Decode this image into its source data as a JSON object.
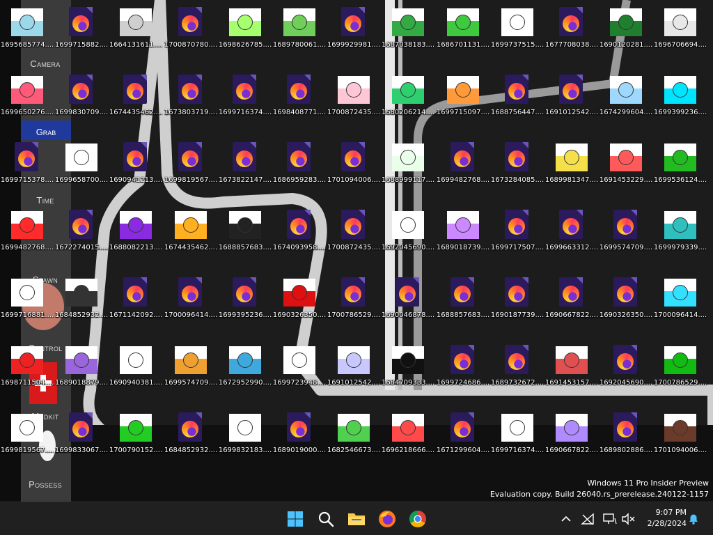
{
  "wallpaper": {
    "sidebar_labels": [
      "Camera",
      "Grab",
      "Time",
      "Spawn",
      "Control",
      "Medkit",
      "Possess"
    ],
    "sidebar_selected": "Grab"
  },
  "desktop": {
    "icons": [
      {
        "label": "1695685774....",
        "type": "img",
        "tint": "#9ad8ea"
      },
      {
        "label": "1699715882....",
        "type": "ff"
      },
      {
        "label": "1664131611....",
        "type": "img",
        "tint": "#cfcfcf"
      },
      {
        "label": "1700870780....",
        "type": "ff"
      },
      {
        "label": "1698626785....",
        "type": "img",
        "tint": "#a6ff6e"
      },
      {
        "label": "1689780061....",
        "type": "img",
        "tint": "#6fcf5a"
      },
      {
        "label": "1699929981....",
        "type": "ff"
      },
      {
        "label": "1687038183....",
        "type": "img",
        "tint": "#33aa44"
      },
      {
        "label": "1686701131....",
        "type": "img",
        "tint": "#3fc93f"
      },
      {
        "label": "1699737515....",
        "type": "img",
        "tint": "#ffffff"
      },
      {
        "label": "1677708038....",
        "type": "ff"
      },
      {
        "label": "1690120281....",
        "type": "img",
        "tint": "#1f7f2f"
      },
      {
        "label": "1696706694....",
        "type": "img",
        "tint": "#e8e8e8"
      },
      {
        "label": "1699650276....",
        "type": "img",
        "tint": "#ff5a7a"
      },
      {
        "label": "1699830709....",
        "type": "ff"
      },
      {
        "label": "1674435462....",
        "type": "ff"
      },
      {
        "label": "1673803719....",
        "type": "ff"
      },
      {
        "label": "1699716374....",
        "type": "ff"
      },
      {
        "label": "1698408771....",
        "type": "ff"
      },
      {
        "label": "1700872435....",
        "type": "img",
        "tint": "#ffc6d6"
      },
      {
        "label": "1680206214....",
        "type": "img",
        "tint": "#2fcf6f"
      },
      {
        "label": "1699715097....",
        "type": "img",
        "tint": "#ff9a3a"
      },
      {
        "label": "1688756447....",
        "type": "ff"
      },
      {
        "label": "1691012542....",
        "type": "ff"
      },
      {
        "label": "1674299604....",
        "type": "img",
        "tint": "#9fd8ff"
      },
      {
        "label": "1699399236....",
        "type": "img",
        "tint": "#00e5ff"
      },
      {
        "label": "1699715378....",
        "type": "ff"
      },
      {
        "label": "1699658700....",
        "type": "img",
        "tint": "#ffffff"
      },
      {
        "label": "1690941213....",
        "type": "ff"
      },
      {
        "label": "1699819567....",
        "type": "ff"
      },
      {
        "label": "1673822147....",
        "type": "ff"
      },
      {
        "label": "1686959283....",
        "type": "ff"
      },
      {
        "label": "1701094006....",
        "type": "ff"
      },
      {
        "label": "1688999117....",
        "type": "img",
        "tint": "#eaffea"
      },
      {
        "label": "1699482768....",
        "type": "ff"
      },
      {
        "label": "1673284085....",
        "type": "ff"
      },
      {
        "label": "1689981347....",
        "type": "img",
        "tint": "#f5e04a"
      },
      {
        "label": "1691453229....",
        "type": "img",
        "tint": "#ff5a5a"
      },
      {
        "label": "1699536124....",
        "type": "img",
        "tint": "#22bb22"
      },
      {
        "label": "1699482768....",
        "type": "img",
        "tint": "#ff2a2a"
      },
      {
        "label": "1672274015....",
        "type": "ff"
      },
      {
        "label": "1688082213....",
        "type": "img",
        "tint": "#8a2be2"
      },
      {
        "label": "1674435462....",
        "type": "img",
        "tint": "#ffb020"
      },
      {
        "label": "1688857683....",
        "type": "img",
        "tint": "#222222"
      },
      {
        "label": "1674093958....",
        "type": "ff"
      },
      {
        "label": "1700872435....",
        "type": "ff"
      },
      {
        "label": "1692045690....",
        "type": "img",
        "tint": "#ffffff"
      },
      {
        "label": "1689018739....",
        "type": "img",
        "tint": "#cc88ff"
      },
      {
        "label": "1699717507....",
        "type": "ff"
      },
      {
        "label": "1699663312....",
        "type": "ff"
      },
      {
        "label": "1699574709....",
        "type": "ff"
      },
      {
        "label": "1699979339....",
        "type": "img",
        "tint": "#2fbfbf"
      },
      {
        "label": "1699716881....",
        "type": "img",
        "tint": "#ffffff"
      },
      {
        "label": "1684852932....",
        "type": "img",
        "tint": "#333333"
      },
      {
        "label": "1671142092....",
        "type": "ff"
      },
      {
        "label": "1700096414....",
        "type": "ff"
      },
      {
        "label": "1699395236....",
        "type": "ff"
      },
      {
        "label": "1690326350....",
        "type": "img",
        "tint": "#dd1111"
      },
      {
        "label": "1700786529....",
        "type": "ff"
      },
      {
        "label": "1690046878....",
        "type": "ff"
      },
      {
        "label": "1688857683....",
        "type": "ff"
      },
      {
        "label": "1690187739....",
        "type": "ff"
      },
      {
        "label": "1690667822....",
        "type": "ff"
      },
      {
        "label": "1690326350....",
        "type": "ff"
      },
      {
        "label": "1700096414....",
        "type": "img",
        "tint": "#33e0ff"
      },
      {
        "label": "1698711504....",
        "type": "img",
        "tint": "#ee2222"
      },
      {
        "label": "1689018879....",
        "type": "img",
        "tint": "#9966dd"
      },
      {
        "label": "1690940381....",
        "type": "img",
        "tint": "#ffffff"
      },
      {
        "label": "1699574709....",
        "type": "img",
        "tint": "#f0a030"
      },
      {
        "label": "1672952990....",
        "type": "img",
        "tint": "#3fa9dd"
      },
      {
        "label": "1699723948....",
        "type": "img",
        "tint": "#ffffff"
      },
      {
        "label": "1691012542....",
        "type": "img",
        "tint": "#c8c8ff"
      },
      {
        "label": "1684709333....",
        "type": "img",
        "tint": "#111111"
      },
      {
        "label": "1699724686....",
        "type": "ff"
      },
      {
        "label": "1689732672....",
        "type": "ff"
      },
      {
        "label": "1691453157....",
        "type": "img",
        "tint": "#e05050"
      },
      {
        "label": "1692045690....",
        "type": "ff"
      },
      {
        "label": "1700786529....",
        "type": "img",
        "tint": "#11bb11"
      },
      {
        "label": "1699819567....",
        "type": "img",
        "tint": "#ffffff"
      },
      {
        "label": "1699833067....",
        "type": "ff"
      },
      {
        "label": "1700790152....",
        "type": "img",
        "tint": "#22cc22"
      },
      {
        "label": "1684852932....",
        "type": "ff"
      },
      {
        "label": "1699832183....",
        "type": "img",
        "tint": "#ffffff"
      },
      {
        "label": "1689019000....",
        "type": "ff"
      },
      {
        "label": "1682546673....",
        "type": "img",
        "tint": "#4fd04f"
      },
      {
        "label": "1696218666....",
        "type": "img",
        "tint": "#ff4a4a"
      },
      {
        "label": "1671299604....",
        "type": "ff"
      },
      {
        "label": "1699716374....",
        "type": "img",
        "tint": "#ffffff"
      },
      {
        "label": "1690667822....",
        "type": "img",
        "tint": "#b08aff"
      },
      {
        "label": "1689802886....",
        "type": "ff"
      },
      {
        "label": "1701094006....",
        "type": "img",
        "tint": "#6a3a2a"
      }
    ]
  },
  "watermark": {
    "line1": "Windows 11 Pro Insider Preview",
    "line2": "Evaluation copy. Build 26040.rs_prerelease.240122-1157"
  },
  "clock": {
    "time": "9:07 PM",
    "date": "2/28/2024"
  },
  "colors": {
    "taskbar": "#202020",
    "accent": "#0a84ff"
  }
}
